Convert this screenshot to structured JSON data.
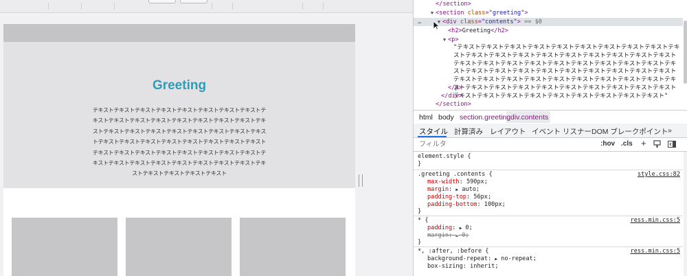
{
  "page": {
    "greeting_title": "Greeting",
    "greeting_text": "テキストテキストテキストテキストテキストテキストテキストテキストテキストテキストテキストテキストテキストテキストテキストテキストテキストテキストテキストテキストテキストテキストテキストテキストテキストテキストテキストテキストテキストテキストテキストテキストテキストテキストテキストテキストテキストテキストテキストテキストテキストテキストテキストテキストテキストテキストテキストテキストテキストテキストテキストテキストテキストテキスト"
  },
  "elements": {
    "section_close_top": "</section>",
    "section_open_tag": "section",
    "section_class_attr": "class",
    "section_class_val": "\"greeting\"",
    "div_tag": "div",
    "div_class_attr": "class",
    "div_class_val": "\"contents\"",
    "div_suffix": "== $0",
    "dots": "…",
    "h2_open": "<h2>",
    "h2_text": "Greeting",
    "h2_close": "</h2>",
    "p_open": "<p>",
    "p_text": "\"テキストテキストテキストテキストテキストテキストテキストテキストテキストテキストテキストテキストテキストテキストテキストテキストテキストテキストテキストテキストテキストテキストテキストテキストテキストテキストテキストテキストテキストテキストテキストテキストテキストテキストテキストテキストテキストテキストテキストテキストテキストテキストテキストテキストテキストテキストテキストテキストテキストテキストテキストテキストテキストテキストテキストテキストテキストテキストテキストテキストテキストテキストテキストテキストテキストテキスト\"",
    "p_close": "</p>",
    "div_close": "</div>",
    "section_close": "</section>"
  },
  "breadcrumb": [
    "html",
    "body",
    "section.greeting",
    "div.contents"
  ],
  "tabs": [
    "スタイル",
    "計算済み",
    "レイアウト",
    "イベント リスナー",
    "DOM ブレークポイント",
    "»"
  ],
  "filter": {
    "placeholder": "フィルタ",
    "hov": ":hov",
    "cls": ".cls",
    "plus": "+"
  },
  "styles": {
    "element_style": "element.style {",
    "close": "}",
    "rule1_selector": ".greeting .contents {",
    "rule1_source": "style.css:82",
    "rule1_props": [
      {
        "name": "max-width",
        "value": "590px;"
      },
      {
        "name": "margin",
        "value": "auto;"
      },
      {
        "name": "padding-top",
        "value": "56px;"
      },
      {
        "name": "padding-bottom",
        "value": "100px;"
      }
    ],
    "rule2_selector": "* {",
    "rule2_source": "ress.min.css:5",
    "rule2_props": [
      {
        "name": "padding",
        "value": "0;"
      },
      {
        "name": "margin",
        "value": "0;"
      }
    ],
    "rule3_selector": "*, :after, :before {",
    "rule3_source": "ress.min.css:5",
    "rule3_props": [
      {
        "name": "background-repeat",
        "value": "no-repeat;"
      },
      {
        "name": "box-sizing",
        "value": "inherit;"
      }
    ]
  },
  "colors": {
    "greeting_title": "#2e9cb5",
    "tag": "#881280",
    "attr": "#994500",
    "attr_value": "#1a1aa6",
    "css_property": "#c80000",
    "selection": "#dfe3e8",
    "active_tab": "#1a73e8"
  }
}
